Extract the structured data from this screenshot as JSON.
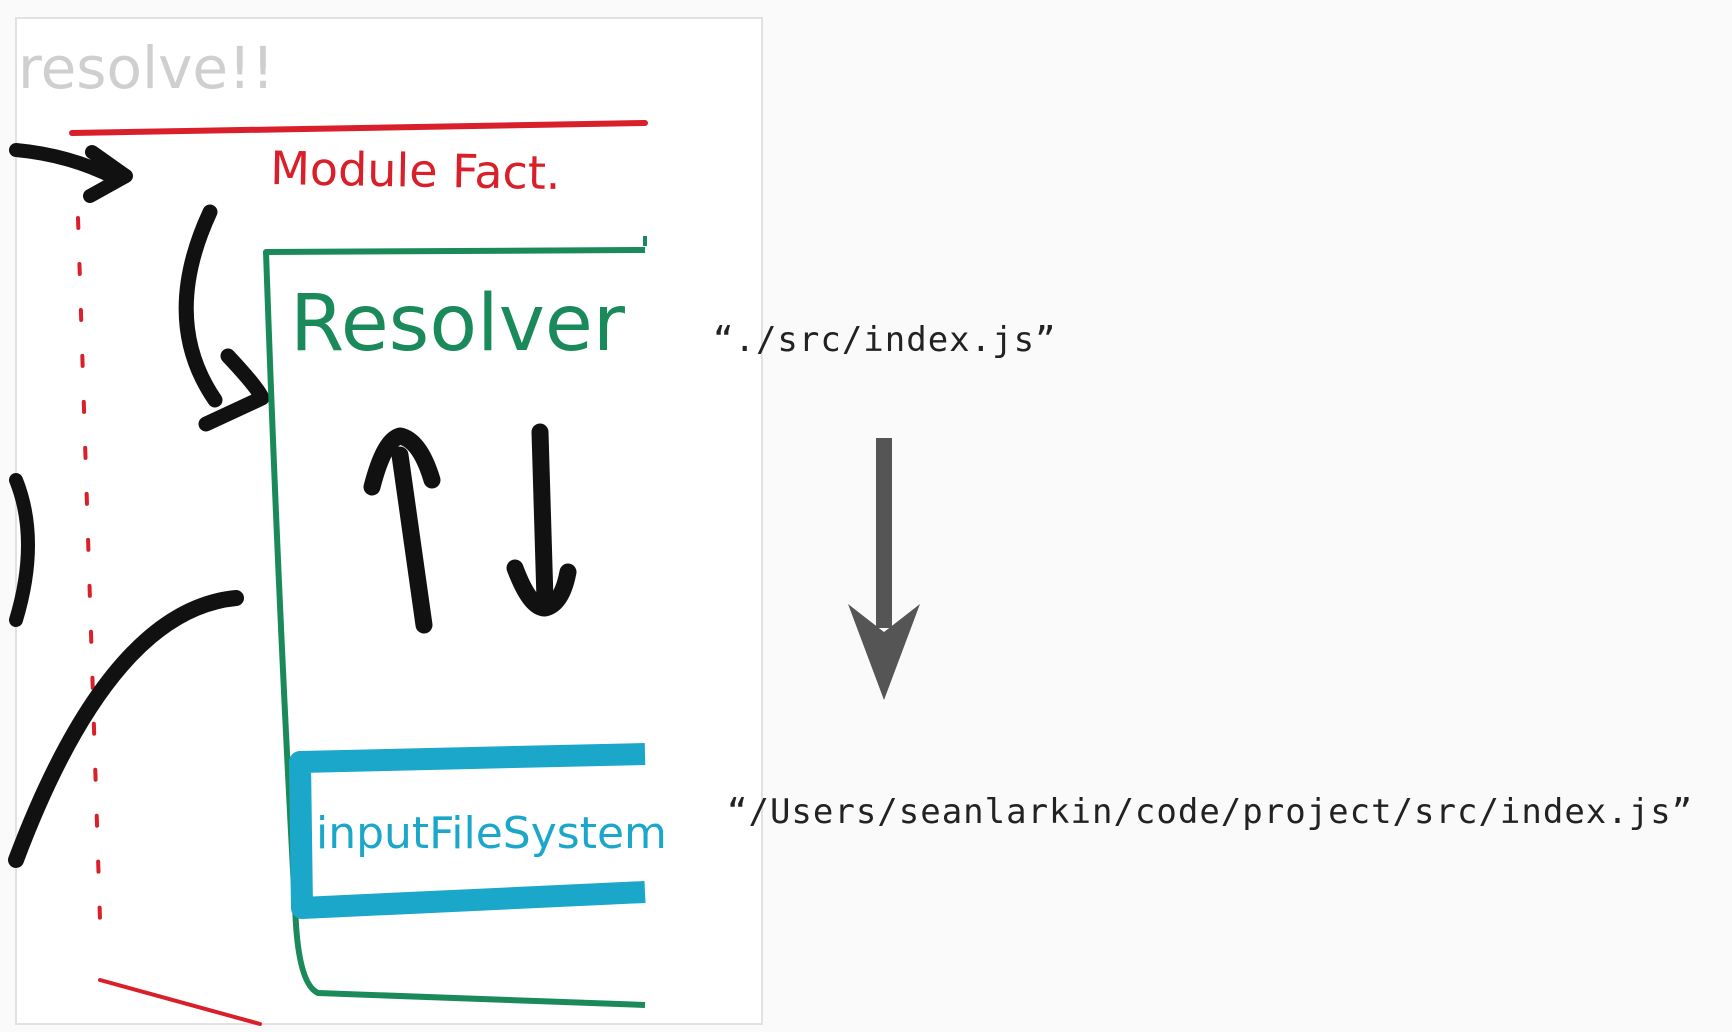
{
  "sketch": {
    "heading": "resolve!!",
    "module_factory_label": "Module Fact.",
    "resolver_label": "Resolver",
    "input_file_system_label": "inputFileSystem"
  },
  "resolution": {
    "source_path": "“./src/index.js”",
    "resolved_path": "“/Users/seanlarkin/code/project/src/index.js”"
  },
  "colors": {
    "module_factory": "#d81f2a",
    "resolver": "#1b8a5a",
    "input_file_system": "#1aa7c9",
    "arrow": "#555555",
    "ink": "#111111"
  },
  "icons": {
    "resolution_arrow": "down-arrow-icon"
  }
}
